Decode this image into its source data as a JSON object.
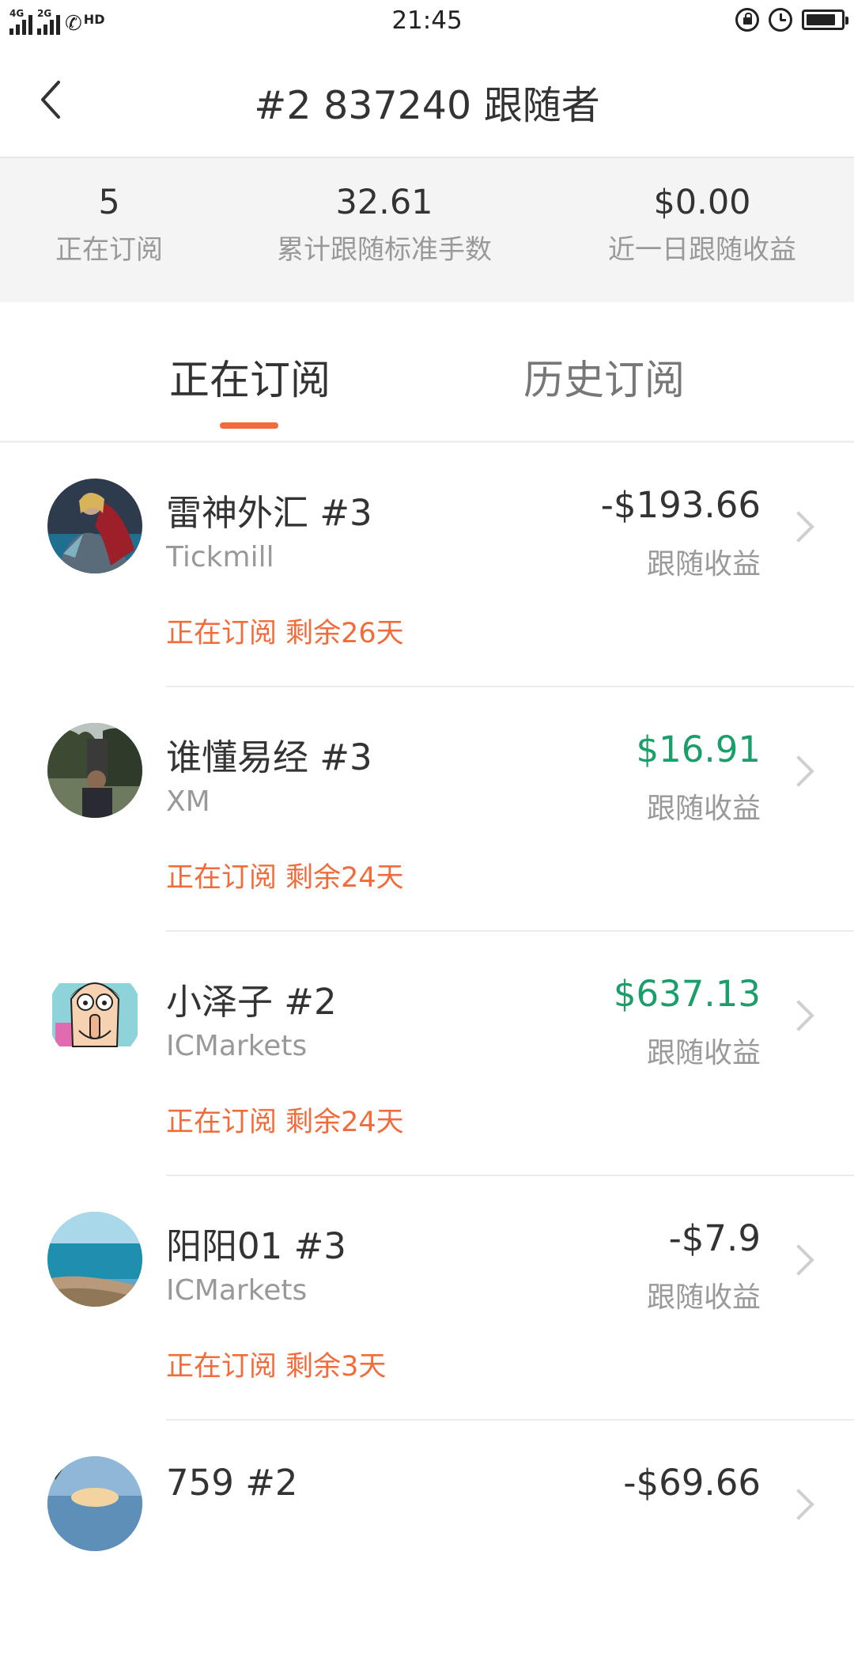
{
  "status_bar": {
    "time": "21:45",
    "net1": "4G",
    "net2": "2G",
    "call": "HD",
    "icons": [
      "signal-icon",
      "phone-icon",
      "lock-rotation-icon",
      "alarm-icon",
      "battery-icon"
    ]
  },
  "header": {
    "title": "#2 837240 跟随者",
    "back_icon": "chevron-left-icon"
  },
  "stats": [
    {
      "value": "5",
      "label": "正在订阅"
    },
    {
      "value": "32.61",
      "label": "累计跟随标准手数"
    },
    {
      "value": "$0.00",
      "label": "近一日跟随收益"
    }
  ],
  "tabs": [
    {
      "label": "正在订阅",
      "active": true
    },
    {
      "label": "历史订阅",
      "active": false
    }
  ],
  "colors": {
    "accent": "#f26b3a",
    "positive": "#1a9e6a",
    "text": "#333333",
    "muted": "#999999"
  },
  "subscriptions": [
    {
      "name": "雷神外汇 #3",
      "broker": "Tickmill",
      "amount": "-$193.66",
      "amount_label": "跟随收益",
      "status": "正在订阅 剩余26天",
      "sign": "negative"
    },
    {
      "name": "谁懂易经 #3",
      "broker": "XM",
      "amount": "$16.91",
      "amount_label": "跟随收益",
      "status": "正在订阅 剩余24天",
      "sign": "positive"
    },
    {
      "name": "小泽子 #2",
      "broker": "ICMarkets",
      "amount": "$637.13",
      "amount_label": "跟随收益",
      "status": "正在订阅 剩余24天",
      "sign": "positive"
    },
    {
      "name": "阳阳01 #3",
      "broker": "ICMarkets",
      "amount": "-$7.9",
      "amount_label": "跟随收益",
      "status": "正在订阅 剩余3天",
      "sign": "negative"
    },
    {
      "name": "759 #2",
      "broker": "",
      "amount": "-$69.66",
      "amount_label": "",
      "status": "",
      "sign": "negative"
    }
  ]
}
